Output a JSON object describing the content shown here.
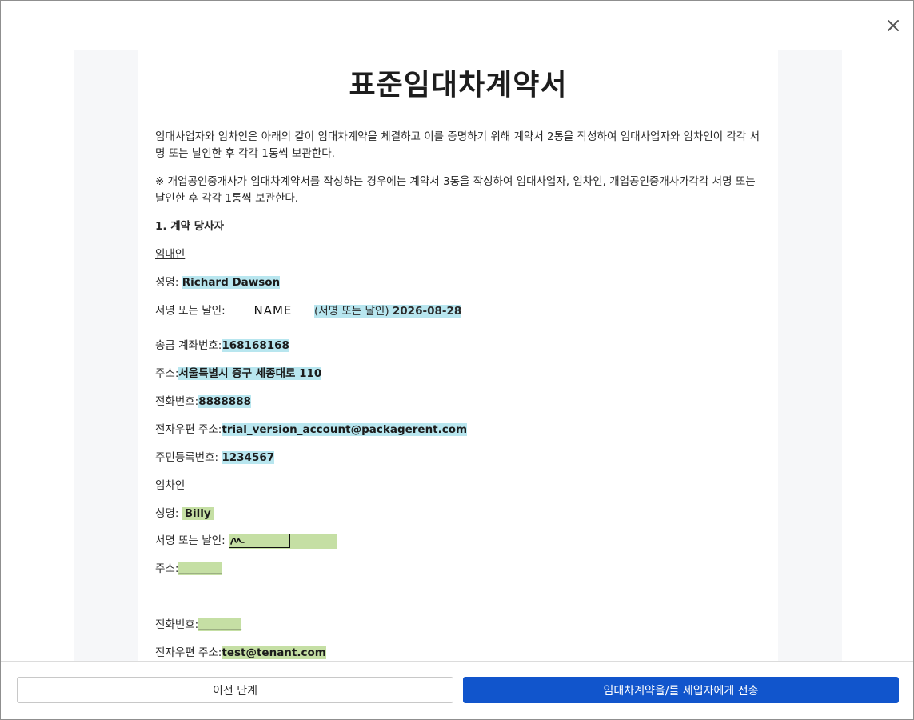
{
  "modal": {
    "close_icon": "close-icon"
  },
  "document": {
    "title": "표준임대차계약서",
    "intro_1": "임대사업자와 임차인은 아래의 같이 임대차계약을 체결하고 이를 증명하기 위해 계약서 2통을 작성하여 임대사업자와 임차인이 각각 서명 또는 날인한 후 각각 1통씩 보관한다.",
    "intro_2": "※ 개업공인중개사가 임대차계약서를 작성하는 경우에는 계약서 3통을 작성하여 임대사업자, 임차인, 개업공인중개사가각각 서명 또는 날인한 후 각각 1통씩 보관한다.",
    "section_1": "1. 계약 당사자",
    "landlord": {
      "heading": "임대인",
      "name_label": "성명: ",
      "name_value": "Richard Dawson",
      "sign_label": "서명 또는 날인: ",
      "sign_name": "NAME",
      "sign_suffix": "(서명 또는 날인) ",
      "sign_date": "2026-08-28",
      "account_label": "송금 계좌번호:",
      "account_value": "168168168",
      "address_label": "주소:",
      "address_value": "서울특별시 중구 세종대로 110",
      "phone_label": "전화번호:",
      "phone_value": "8888888",
      "email_label": "전자우편 주소:",
      "email_value": "trial_version_account@packagerent.com",
      "id_label": "주민등록번호: ",
      "id_value": "1234567"
    },
    "tenant": {
      "heading": "임차인",
      "name_label": "성명:  ",
      "name_value": "Billy",
      "sign_label": "서명 또는 날인: ",
      "address_label": "주소:",
      "address_value": "________",
      "phone_label": "전화번호:",
      "phone_value": "________",
      "email_label": "전자우편 주소:",
      "email_value": "test@tenant.com"
    }
  },
  "footer": {
    "prev_label": "이전 단계",
    "send_label": "임대차계약을/를 세입자에게 전송"
  },
  "colors": {
    "primary": "#1155cc",
    "highlight_landlord": "#b8e6ef",
    "highlight_tenant": "#c5dfa4"
  }
}
